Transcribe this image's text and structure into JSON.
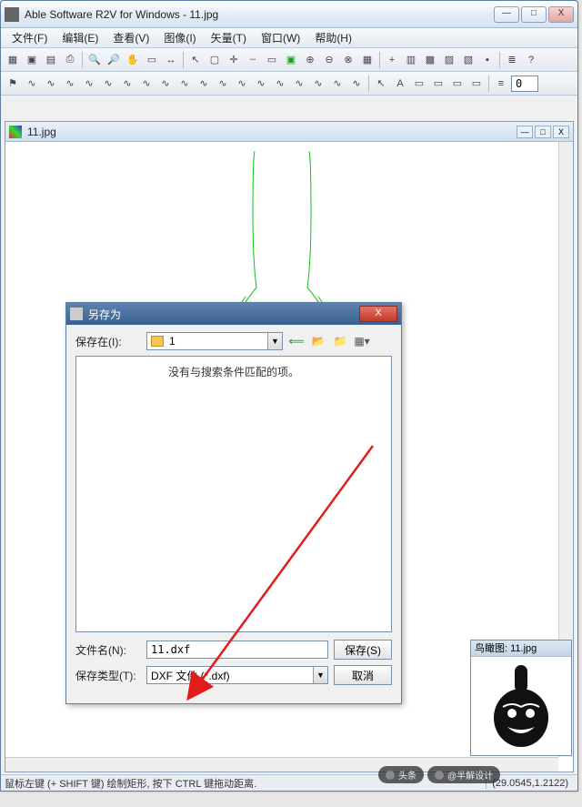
{
  "app": {
    "title": "Able Software R2V for Windows - 11.jpg",
    "window_buttons": {
      "min": "—",
      "max": "□",
      "close": "X"
    }
  },
  "menu": [
    "文件(F)",
    "编辑(E)",
    "查看(V)",
    "图像(I)",
    "矢量(T)",
    "窗口(W)",
    "帮助(H)"
  ],
  "document": {
    "title": "11.jpg",
    "buttons": {
      "min": "—",
      "max": "□",
      "close": "X"
    }
  },
  "thumbnail": {
    "title": "鸟瞰图: 11.jpg"
  },
  "statusbar": {
    "hint": "鼠标左键 (+ SHIFT 键) 绘制矩形, 按下 CTRL 键拖动距离.",
    "coords": "(29.0545,1.2122)"
  },
  "dialog": {
    "title": "另存为",
    "save_in_label": "保存在(I):",
    "folder_name": "1",
    "empty_msg": "没有与搜索条件匹配的项。",
    "filename_label": "文件名(N):",
    "filename_value": "11.dxf",
    "filetype_label": "保存类型(T):",
    "filetype_value": "DXF 文件 (*.dxf)",
    "save_btn": "保存(S)",
    "cancel_btn": "取消"
  },
  "toolbar_input": "0",
  "watermark": {
    "a": "头条",
    "b": "@半解设计"
  }
}
